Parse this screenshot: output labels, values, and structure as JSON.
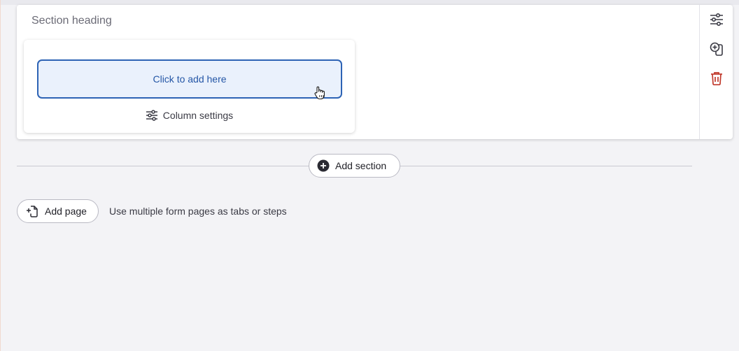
{
  "section": {
    "heading": "Section heading"
  },
  "column": {
    "add_here_label": "Click to add here",
    "settings_label": "Column settings"
  },
  "toolbar": {
    "icons": [
      "sliders-icon",
      "clone-icon",
      "trash-icon"
    ]
  },
  "actions": {
    "add_section_label": "Add section",
    "add_page_label": "Add page",
    "add_page_hint": "Use multiple form pages as tabs or steps"
  },
  "colors": {
    "accent": "#2d63b5",
    "drop_zone_bg": "#eaf1fc",
    "danger": "#c0392b",
    "background": "#f3f3f6"
  }
}
